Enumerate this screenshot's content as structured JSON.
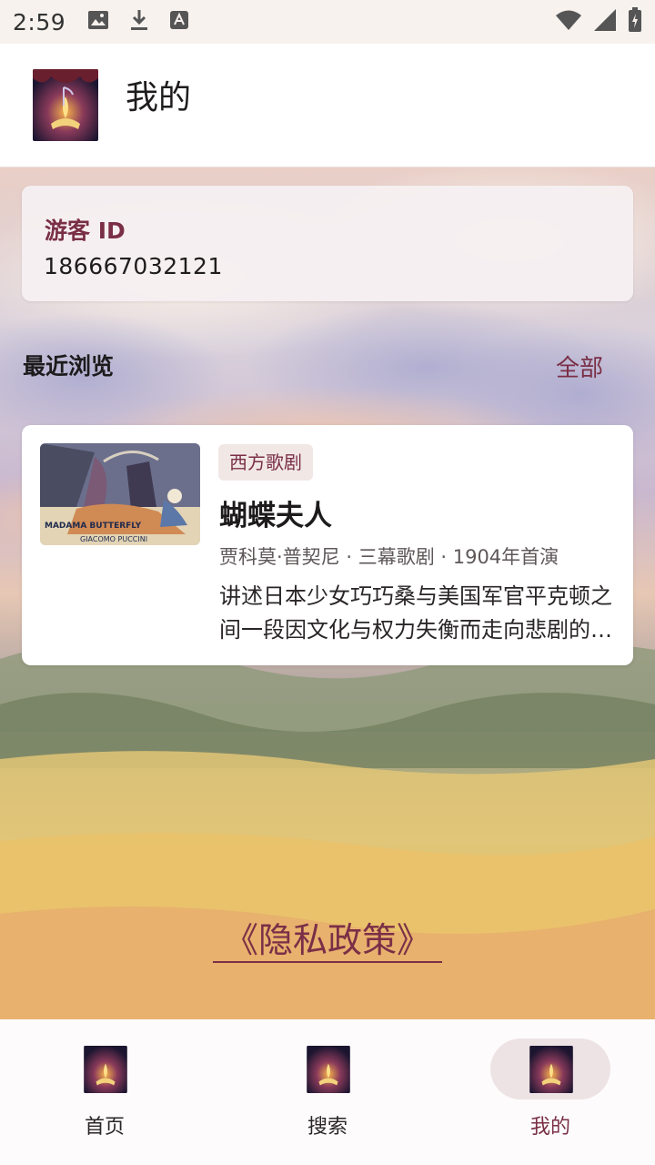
{
  "status_bar": {
    "time": "2:59",
    "left_icons": [
      "image-icon",
      "download-icon",
      "a-notification-icon"
    ],
    "right_icons": [
      "wifi-icon",
      "signal-icon",
      "battery-icon"
    ]
  },
  "app_bar": {
    "title": "我的",
    "logo": "app-logo-icon"
  },
  "guest": {
    "label": "游客 ID",
    "id": "186667032121"
  },
  "recent": {
    "title": "最近浏览",
    "all_label": "全部",
    "items": [
      {
        "tag": "西方歌剧",
        "title": "蝴蝶夫人",
        "meta": "贾科莫·普契尼 · 三幕歌剧 · 1904年首演",
        "description": "讲述日本少女巧巧桑与美国军官平克顿之间一段因文化与权力失衡而走向悲剧的爱情故事。",
        "thumb_caption_1": "MADAMA BUTTERFLY",
        "thumb_caption_2": "GIACOMO PUCCINI"
      }
    ]
  },
  "privacy_label": "《隐私政策》",
  "nav": {
    "items": [
      {
        "label": "首页",
        "icon": "home-logo-icon",
        "active": false
      },
      {
        "label": "搜索",
        "icon": "search-logo-icon",
        "active": false
      },
      {
        "label": "我的",
        "icon": "mine-logo-icon",
        "active": true
      }
    ]
  },
  "colors": {
    "accent": "#7a2f47",
    "card_bg": "#ffffff",
    "tag_bg": "#f1e8e6"
  }
}
